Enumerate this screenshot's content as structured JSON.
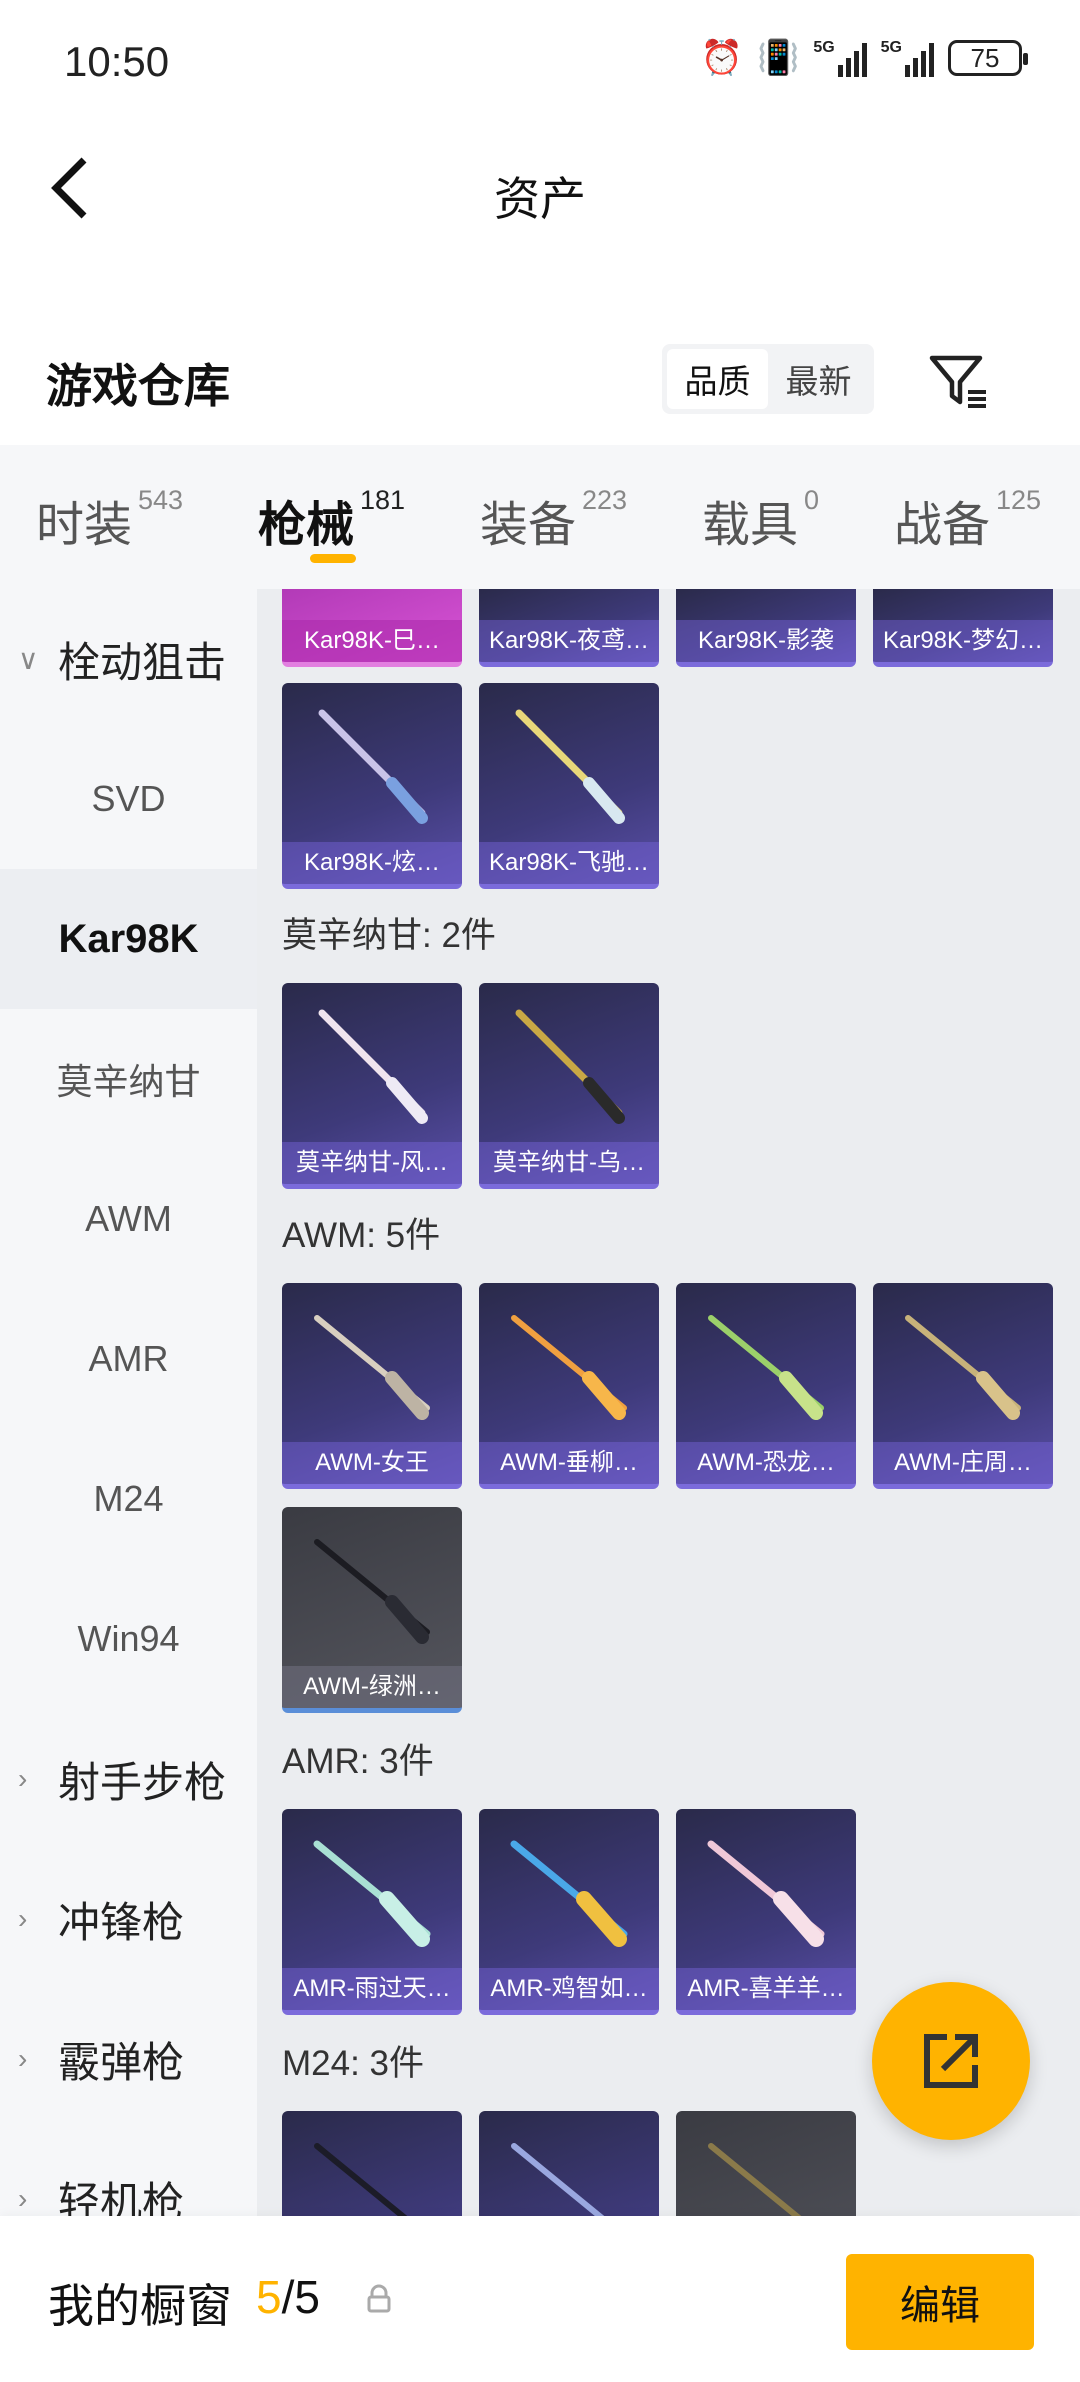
{
  "status_bar": {
    "time": "10:50",
    "network_1": "5G",
    "network_2": "5G",
    "battery": "75"
  },
  "header": {
    "title": "资产"
  },
  "warehouse": {
    "title": "游戏仓库",
    "sort": [
      "品质",
      "最新"
    ],
    "sort_active": 0
  },
  "tabs": [
    {
      "label": "时装",
      "count": "543"
    },
    {
      "label": "枪械",
      "count": "181"
    },
    {
      "label": "装备",
      "count": "223"
    },
    {
      "label": "载具",
      "count": "0"
    },
    {
      "label": "战备",
      "count": "125"
    }
  ],
  "active_tab": 1,
  "sidebar": [
    {
      "label": "栓动狙击",
      "type": "category",
      "expanded": true
    },
    {
      "label": "SVD",
      "type": "sub"
    },
    {
      "label": "Kar98K",
      "type": "sub",
      "active": true
    },
    {
      "label": "莫辛纳甘",
      "type": "sub"
    },
    {
      "label": "AWM",
      "type": "sub"
    },
    {
      "label": "AMR",
      "type": "sub"
    },
    {
      "label": "M24",
      "type": "sub"
    },
    {
      "label": "Win94",
      "type": "sub"
    },
    {
      "label": "射手步枪",
      "type": "category"
    },
    {
      "label": "冲锋枪",
      "type": "category"
    },
    {
      "label": "霰弹枪",
      "type": "category"
    },
    {
      "label": "轻机枪",
      "type": "category"
    }
  ],
  "groups": [
    {
      "title": "",
      "items": [
        "Kar98K-巳…",
        "Kar98K-夜鸢…",
        "Kar98K-影袭",
        "Kar98K-梦幻…",
        "Kar98K-炫…",
        "Kar98K-飞驰…"
      ]
    },
    {
      "title": "莫辛纳甘: 2件",
      "items": [
        "莫辛纳甘-风…",
        "莫辛纳甘-乌…"
      ]
    },
    {
      "title": "AWM: 5件",
      "items": [
        "AWM-女王",
        "AWM-垂柳…",
        "AWM-恐龙…",
        "AWM-庄周…",
        "AWM-绿洲…"
      ]
    },
    {
      "title": "AMR: 3件",
      "items": [
        "AMR-雨过天…",
        "AMR-鸡智如…",
        "AMR-喜羊羊…"
      ]
    },
    {
      "title": "M24: 3件",
      "items": [
        "",
        "",
        ""
      ]
    }
  ],
  "bottom": {
    "showcase_label": "我的橱窗",
    "current": "5",
    "total": "/5",
    "edit": "编辑"
  },
  "colors": {
    "accent": "#ffb300",
    "card": "#3e3a7a",
    "card_pink": "#d954d6"
  },
  "icons": [
    "back-arrow-icon",
    "filter-icon",
    "alarm-icon",
    "vibrate-icon",
    "signal-icon",
    "battery-icon",
    "share-icon",
    "lock-icon"
  ]
}
